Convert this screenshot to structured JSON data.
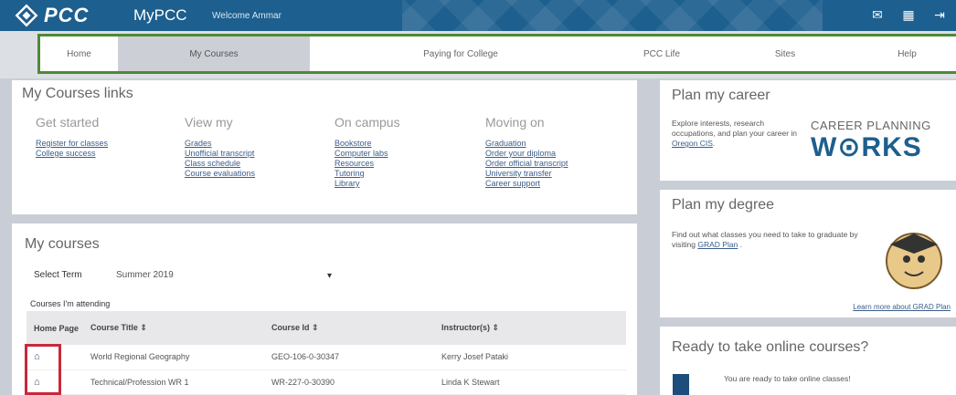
{
  "header": {
    "logo_text": "PCC",
    "app_name": "MyPCC",
    "welcome": "Welcome Ammar",
    "icons": [
      "mail-icon",
      "calendar-icon",
      "logout-icon"
    ]
  },
  "nav": {
    "items": [
      "Home",
      "My Courses",
      "Paying for College",
      "PCC Life",
      "Sites",
      "Help"
    ],
    "active": "My Courses",
    "highlight_color": "#4d8a35"
  },
  "links_panel": {
    "title": "My Courses links",
    "columns": [
      {
        "heading": "Get started",
        "links": [
          "Register for classes",
          "College success"
        ]
      },
      {
        "heading": "View my",
        "links": [
          "Grades",
          "Unofficial transcript",
          "Class schedule",
          "Course evaluations"
        ]
      },
      {
        "heading": "On campus",
        "links": [
          "Bookstore",
          "Computer labs",
          "Resources",
          "Tutoring",
          "Library"
        ]
      },
      {
        "heading": "Moving on",
        "links": [
          "Graduation",
          "Order your diploma",
          "Order official transcript",
          "University transfer",
          "Career support"
        ]
      }
    ]
  },
  "courses_panel": {
    "title": "My courses",
    "term_label": "Select Term",
    "term_value": "Summer 2019",
    "attending_label": "Courses I'm attending",
    "columns": [
      "Home Page",
      "Course Title ⇕",
      "Course Id ⇕",
      "Instructor(s) ⇕"
    ],
    "rows": [
      {
        "title": "World Regional Geography",
        "id": "GEO-106-0-30347",
        "instructor": "Kerry Josef Pataki"
      },
      {
        "title": "Technical/Profession WR 1",
        "id": "WR-227-0-30390",
        "instructor": "Linda K Stewart"
      }
    ],
    "highlight_color": "#c8283a"
  },
  "career_panel": {
    "title": "Plan my career",
    "text": "Explore interests, research occupations, and plan your career in",
    "link": "Oregon CIS",
    "brand_line1": "CAREER PLANNING",
    "brand_line2": "W⊙RKS"
  },
  "degree_panel": {
    "title": "Plan my degree",
    "text": "Find out what classes you need to take to graduate by visiting",
    "link": "GRAD Plan",
    "learn_more": "Learn more about GRAD Plan"
  },
  "online_panel": {
    "title": "Ready to take online courses?",
    "text": "You are ready to take online classes!"
  }
}
